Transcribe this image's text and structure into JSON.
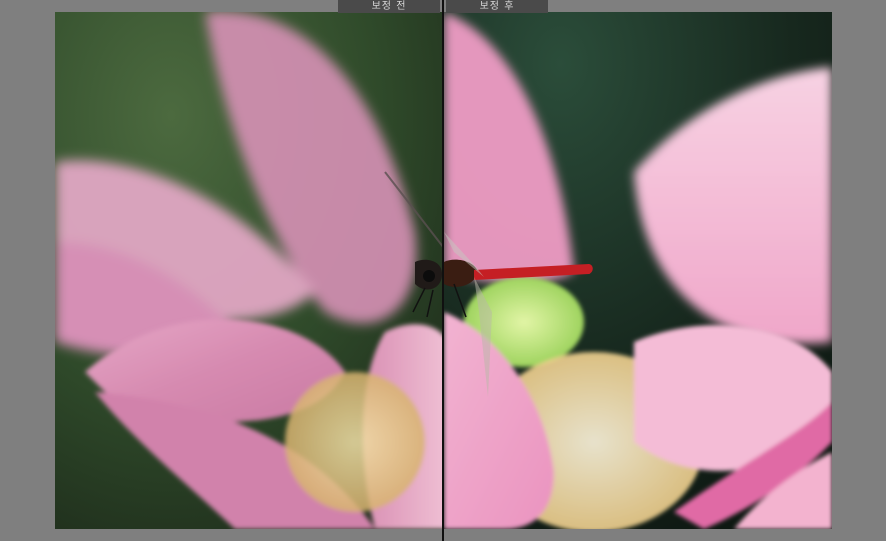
{
  "compare_view": {
    "before_label": "보정 전",
    "after_label": "보정 후"
  },
  "colors": {
    "background": "#7f7f7f",
    "tab_bg": "#4a4a4a",
    "tab_text": "#d6d6d6",
    "divider": "#101010"
  },
  "icons": {
    "before_image": "lotus-dragonfly-photo",
    "after_image": "lotus-dragonfly-photo"
  }
}
